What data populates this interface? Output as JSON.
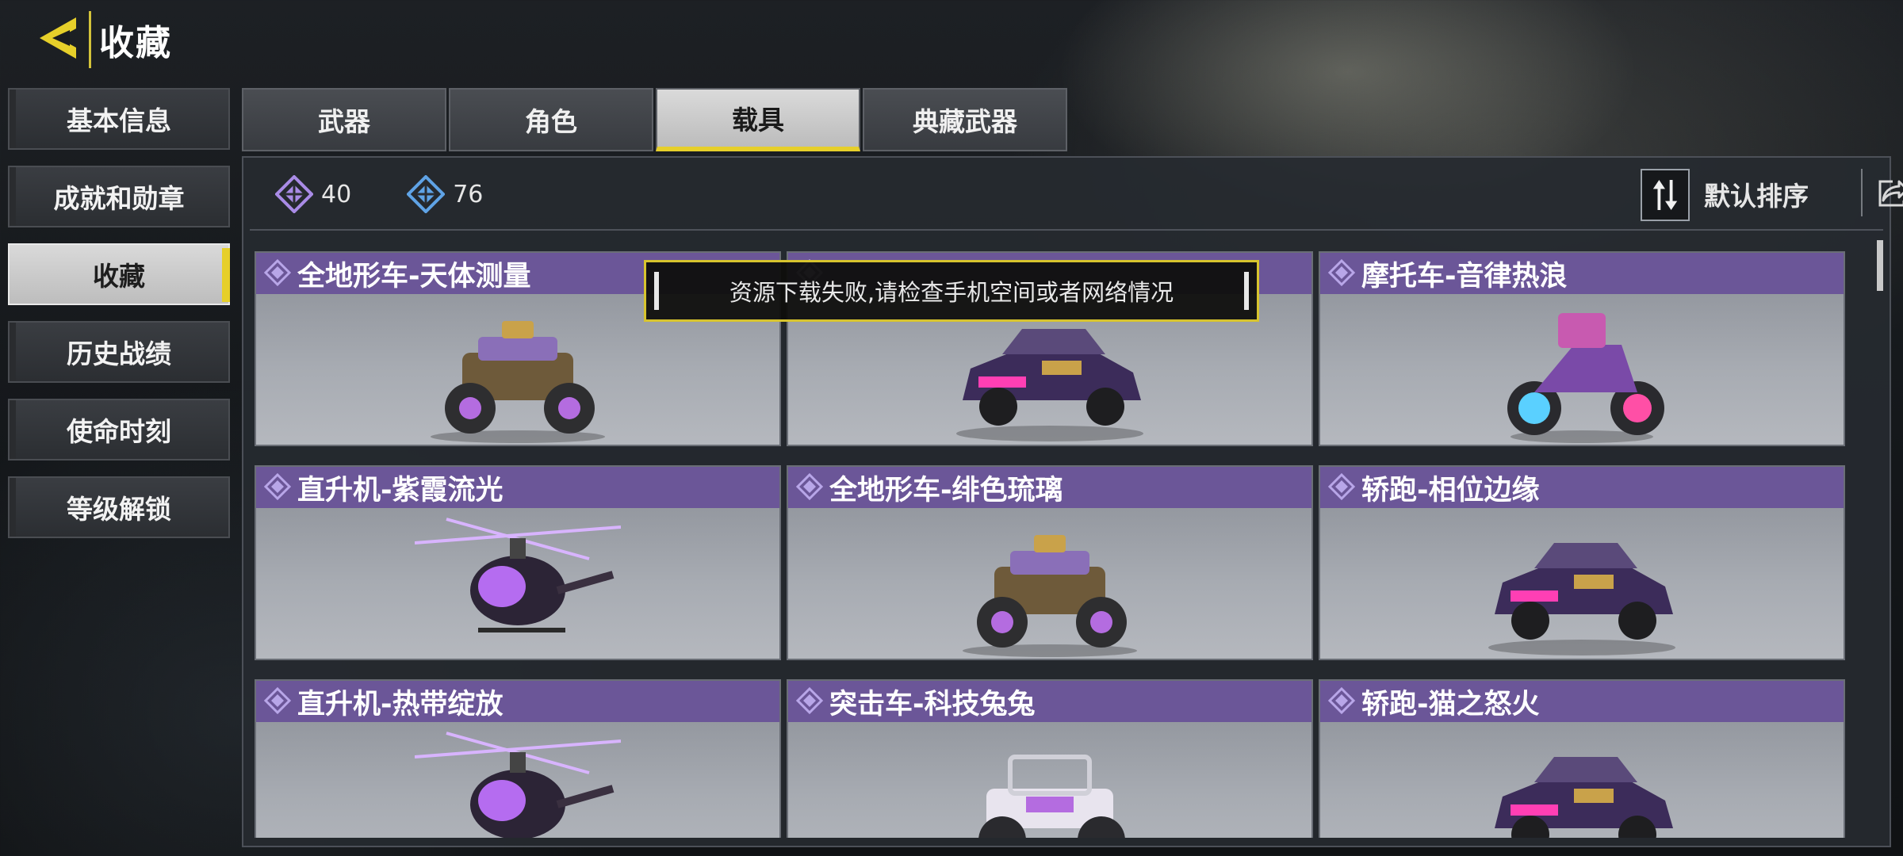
{
  "header": {
    "title": "收藏",
    "back_icon": "chevron-left-icon",
    "accent": "#e6cf2a"
  },
  "nav": [
    {
      "label": "基本信息",
      "selected": false
    },
    {
      "label": "成就和勋章",
      "selected": false
    },
    {
      "label": "收藏",
      "selected": true
    },
    {
      "label": "历史战绩",
      "selected": false
    },
    {
      "label": "使命时刻",
      "selected": false
    },
    {
      "label": "等级解锁",
      "selected": false
    }
  ],
  "tabs": [
    {
      "label": "武器",
      "selected": false
    },
    {
      "label": "角色",
      "selected": false
    },
    {
      "label": "载具",
      "selected": true
    },
    {
      "label": "典藏武器",
      "selected": false
    }
  ],
  "counts": [
    {
      "icon": "purple-diamond-icon",
      "value": "40",
      "color": "#a98be6"
    },
    {
      "icon": "blue-diamond-icon",
      "value": "76",
      "color": "#5fa3e6"
    }
  ],
  "sort": {
    "label": "默认排序",
    "icon": "sort-arrows-icon"
  },
  "share_icon": "share-icon",
  "cards": [
    {
      "title": "全地形车-天体测量",
      "art": "atv"
    },
    {
      "title": "",
      "art": "car"
    },
    {
      "title": "摩托车-音律热浪",
      "art": "motorcycle"
    },
    {
      "title": "直升机-紫霞流光",
      "art": "helicopter"
    },
    {
      "title": "全地形车-绯色琉璃",
      "art": "atv"
    },
    {
      "title": "轿跑-相位边缘",
      "art": "car"
    },
    {
      "title": "直升机-热带绽放",
      "art": "helicopter"
    },
    {
      "title": "突击车-科技兔兔",
      "art": "buggy"
    },
    {
      "title": "轿跑-猫之怒火",
      "art": "car"
    }
  ],
  "toast": {
    "message": "资源下载失败,请检查手机空间或者网络情况"
  },
  "colors": {
    "card_header": "#6b5698",
    "rarity": "#b8a6e8"
  }
}
